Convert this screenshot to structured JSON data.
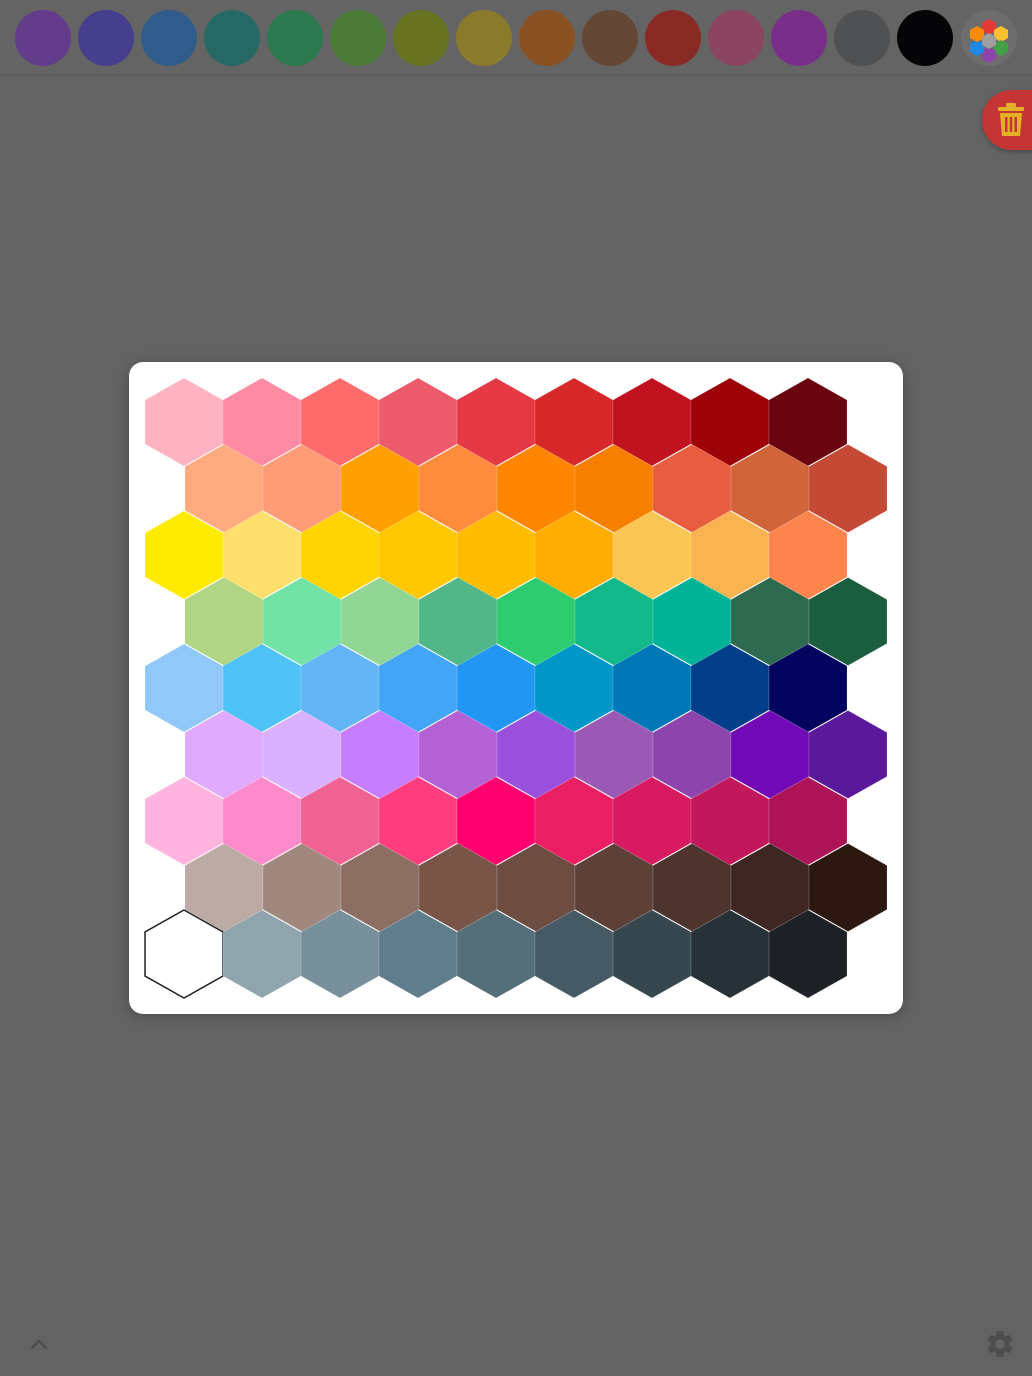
{
  "toolbar": {
    "swatches": [
      {
        "name": "purple",
        "color": "#633c8c"
      },
      {
        "name": "indigo",
        "color": "#453f8d"
      },
      {
        "name": "blue",
        "color": "#2f5c8b"
      },
      {
        "name": "teal",
        "color": "#256864"
      },
      {
        "name": "green",
        "color": "#2d7a50"
      },
      {
        "name": "olive-green",
        "color": "#4a7a35"
      },
      {
        "name": "olive",
        "color": "#677320"
      },
      {
        "name": "mustard",
        "color": "#8a7a2b"
      },
      {
        "name": "orange-brown",
        "color": "#8a5222"
      },
      {
        "name": "brown",
        "color": "#654736"
      },
      {
        "name": "red",
        "color": "#8a2a25"
      },
      {
        "name": "rose",
        "color": "#8c4560"
      },
      {
        "name": "magenta",
        "color": "#792f8a"
      },
      {
        "name": "gray",
        "color": "#4f5152"
      },
      {
        "name": "black",
        "color": "#050507"
      }
    ],
    "palette_icon": "hexagon-palette-icon"
  },
  "trash": {
    "icon": "trash-icon",
    "color": "#c53535",
    "icon_color": "#e3b126"
  },
  "picker": {
    "rows": [
      [
        "#feb2c2",
        "#fe8aa3",
        "#fe6b6b",
        "#ec5a6c",
        "#e63946",
        "#d62828",
        "#c1121f",
        "#9d0208",
        "#6a040f"
      ],
      [
        "#ffab7f",
        "#ff9b76",
        "#ff9f00",
        "#ff8c3d",
        "#ff8600",
        "#f77f00",
        "#e85d3f",
        "#d2643a",
        "#c44a36"
      ],
      [
        "#ffeb00",
        "#ffdf6b",
        "#ffd400",
        "#ffc800",
        "#ffbc00",
        "#ffad00",
        "#fbc653",
        "#f9b451",
        "#fe844d"
      ],
      [
        "#b0d584",
        "#72e2a6",
        "#91d694",
        "#52b788",
        "#2ecc71",
        "#13b88a",
        "#00b397",
        "#2d6a4f",
        "#1b5e3f"
      ],
      [
        "#90c9f9",
        "#4fc3f7",
        "#64b5f6",
        "#42a5f5",
        "#2196f3",
        "#0096c7",
        "#0077b6",
        "#023e8a",
        "#03045e"
      ],
      [
        "#e0aaff",
        "#dab1fe",
        "#c77dff",
        "#b561d6",
        "#9b4fdd",
        "#9b59b6",
        "#8e44ad",
        "#7209b7",
        "#5a189a"
      ],
      [
        "#ffb3de",
        "#ff8acb",
        "#f06292",
        "#ff3d7f",
        "#ff006e",
        "#e91e63",
        "#d81b60",
        "#c2185b",
        "#ad1457"
      ],
      [
        "#bcaaa4",
        "#a1887f",
        "#8d6e63",
        "#795548",
        "#6d4c41",
        "#5d4037",
        "#4e342e",
        "#3e2723",
        "#2c1810"
      ],
      [
        "#ffffff",
        "#90a4ae",
        "#78909c",
        "#607d8b",
        "#546e7a",
        "#455a64",
        "#37474f",
        "#263238",
        "#1e2227"
      ]
    ]
  },
  "footer": {
    "expand_icon": "chevron-up-icon",
    "settings_icon": "gear-icon"
  }
}
